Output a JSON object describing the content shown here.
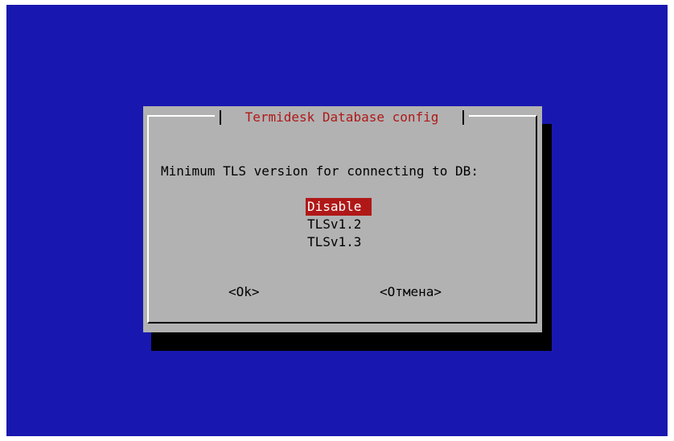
{
  "dialog": {
    "title": "Termidesk Database config",
    "prompt": "Minimum TLS version for connecting to DB:",
    "options": [
      {
        "label": "Disable",
        "selected": true
      },
      {
        "label": "TLSv1.2",
        "selected": false
      },
      {
        "label": "TLSv1.3",
        "selected": false
      }
    ],
    "ok_label": "<Ok>",
    "cancel_label": "<Отмена>"
  },
  "colors": {
    "background": "#1818b0",
    "dialog": "#b2b2b2",
    "title_text": "#b01818",
    "highlight": "#b01818",
    "shadow": "#000000"
  }
}
